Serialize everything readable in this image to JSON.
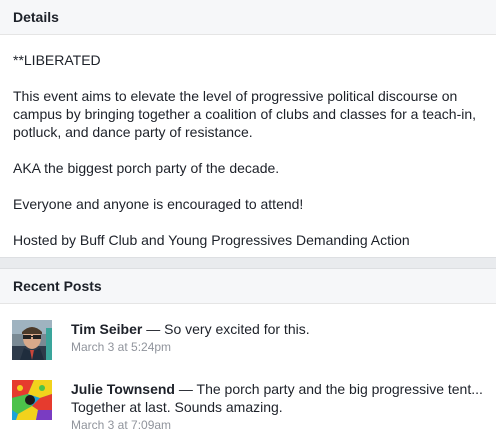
{
  "details": {
    "title": "Details",
    "paragraphs": [
      "**LIBERATED",
      "This event aims to elevate the level of progressive political discourse on campus by bringing together a coalition of clubs and classes for a teach-in, potluck, and dance party of resistance.",
      "AKA the biggest porch party of the decade.",
      "Everyone and anyone is encouraged to attend!",
      "Hosted by Buff Club and Young Progressives Demanding Action"
    ]
  },
  "recent_posts": {
    "title": "Recent Posts",
    "posts": [
      {
        "author": "Tim Seiber",
        "separator": " — ",
        "text": "So very excited for this.",
        "text_line2": "",
        "timestamp": "March 3 at 5:24pm"
      },
      {
        "author": "Julie Townsend",
        "separator": " — ",
        "text": "The porch party and the big progressive tent...",
        "text_line2": "Together at last. Sounds amazing.",
        "timestamp": "March 3 at 7:09am"
      }
    ]
  }
}
